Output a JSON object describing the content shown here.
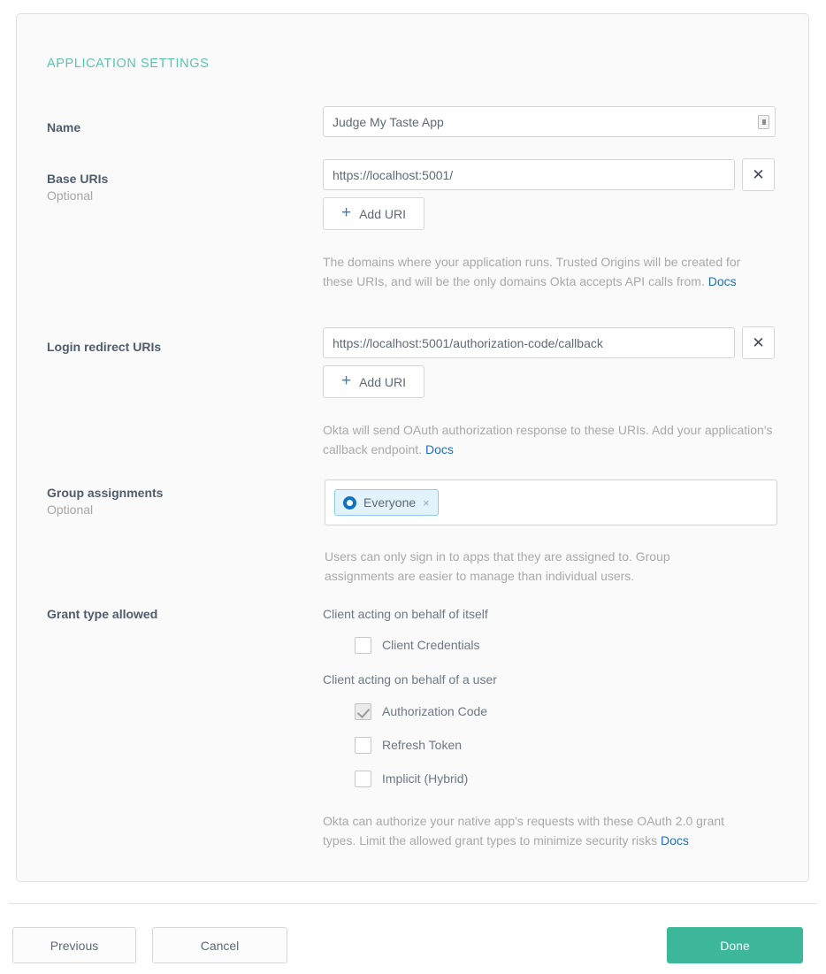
{
  "card": {
    "section_title": "APPLICATION SETTINGS"
  },
  "fields": {
    "name": {
      "label": "Name",
      "value": "Judge My Taste App",
      "placeholder": "",
      "icon": "resize-handle-icon"
    },
    "base_uris": {
      "label": "Base URIs",
      "optional": "Optional",
      "value": "https://localhost:5001/",
      "placeholder": "",
      "remove_label": "✕",
      "add_label": "Add URI",
      "add_plus": "+",
      "help_text": "The domains where your application runs. Trusted Origins will be created for these URIs, and will be the only domains Okta accepts API calls from.",
      "help_link": "Docs"
    },
    "login_redirect_uris": {
      "label": "Login redirect URIs",
      "value": "https://localhost:5001/authorization-code/callback",
      "placeholder": "",
      "remove_label": "✕",
      "add_label": "Add URI",
      "add_plus": "+",
      "help_text": "Okta will send OAuth authorization response to these URIs. Add your application's callback endpoint.",
      "help_link": "Docs"
    },
    "group_assignments": {
      "label": "Group assignments",
      "optional": "Optional",
      "chips": [
        {
          "name": "Everyone",
          "remove": "×",
          "icon": "okta-group-icon"
        }
      ],
      "help_text": "Users can only sign in to apps that they are assigned to. Group assignments are easier to manage than individual users.",
      "help_link": ""
    },
    "grant_type": {
      "label": "Grant type allowed",
      "groups": [
        {
          "title": "Client acting on behalf of itself",
          "options": [
            {
              "label": "Client Credentials",
              "checked": false
            }
          ]
        },
        {
          "title": "Client acting on behalf of a user",
          "options": [
            {
              "label": "Authorization Code",
              "checked": true
            },
            {
              "label": "Refresh Token",
              "checked": false
            },
            {
              "label": "Implicit (Hybrid)",
              "checked": false
            }
          ]
        }
      ],
      "help_text": "Okta can authorize your native app's requests with these OAuth 2.0 grant types. Limit the allowed grant types to minimize security risks",
      "help_link": "Docs"
    }
  },
  "footer": {
    "previous_label": "Previous",
    "cancel_label": "Cancel",
    "done_label": "Done"
  },
  "colors": {
    "accent_green": "#3cb79a",
    "section_title": "#5bc4ac",
    "link_blue": "#1e6fbd",
    "plus_blue": "#2a7fd4",
    "chip_bg": "#e3f3fc",
    "chip_border": "#8fcbee",
    "okta_blue": "#0f73c0"
  }
}
